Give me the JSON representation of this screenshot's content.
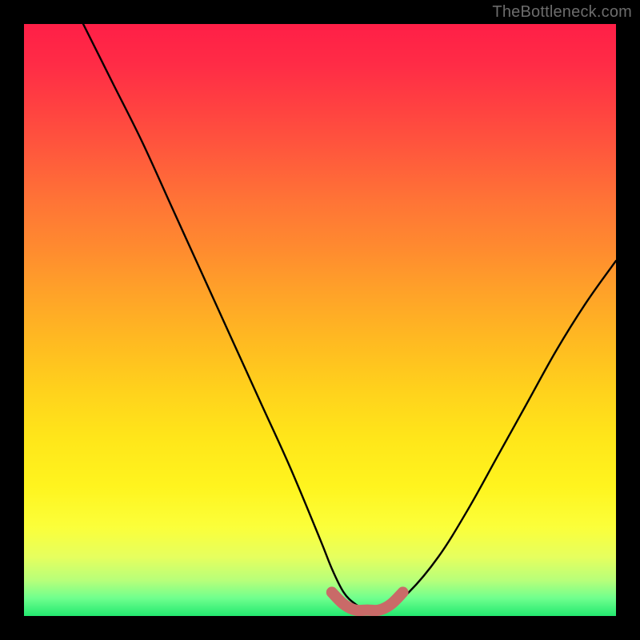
{
  "watermark": "TheBottleneck.com",
  "chart_data": {
    "type": "line",
    "title": "",
    "xlabel": "",
    "ylabel": "",
    "xlim": [
      0,
      100
    ],
    "ylim": [
      0,
      100
    ],
    "series": [
      {
        "name": "bottleneck-curve",
        "color": "#000000",
        "x": [
          10,
          15,
          20,
          25,
          30,
          35,
          40,
          45,
          50,
          52,
          54,
          56,
          58,
          60,
          62,
          65,
          70,
          75,
          80,
          85,
          90,
          95,
          100
        ],
        "y": [
          100,
          90,
          80,
          69,
          58,
          47,
          36,
          25,
          13,
          8,
          4,
          2,
          1,
          1,
          2,
          4,
          10,
          18,
          27,
          36,
          45,
          53,
          60
        ]
      },
      {
        "name": "optimal-zone",
        "color": "#c96a68",
        "x": [
          52,
          54,
          56,
          58,
          60,
          62,
          64
        ],
        "y": [
          4,
          2,
          1,
          1,
          1,
          2,
          4
        ]
      }
    ],
    "gradient_stops": [
      {
        "pos": 0,
        "color": "#ff1f47"
      },
      {
        "pos": 50,
        "color": "#ffd21c"
      },
      {
        "pos": 85,
        "color": "#fbff3a"
      },
      {
        "pos": 100,
        "color": "#23e86f"
      }
    ]
  }
}
